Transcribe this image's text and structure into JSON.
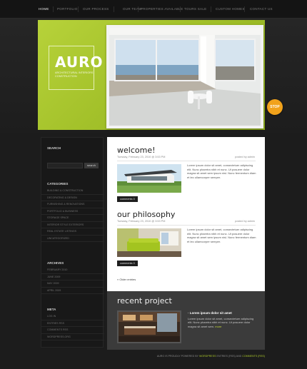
{
  "nav": {
    "items": [
      "Home",
      "Portfolio",
      "Our process",
      "Our team",
      "Properties available",
      "Tours sale",
      "Custom homes",
      "Contact us"
    ]
  },
  "header": {
    "logo_title": "AURO",
    "logo_subtitle": "Architectural Interiors Construction",
    "stop_label": "STOP"
  },
  "sidebar": {
    "search_label": "Search",
    "search_placeholder": "",
    "search_button": "search",
    "categories_label": "Categories",
    "categories": [
      "Building & Construction",
      "Decorating & Design",
      "Furnishing & Renovations",
      "Portfolio & Business",
      "Storage Space",
      "Interior Style Exteriors",
      "Real Estate Listings",
      "Uncategorized"
    ],
    "archives_label": "Archives",
    "archives": [
      "February 2010",
      "June 2009",
      "May 2009",
      "April 2009"
    ],
    "meta_label": "Meta",
    "meta": [
      "Log in",
      "Entries RSS",
      "Comments RSS",
      "WordPress.org"
    ]
  },
  "posts": [
    {
      "title": "welcome!",
      "meta": "Tuesday, February 23, 2010 @ 3:53 PM",
      "author": "posted by admin",
      "text": "Lorem ipsum dolor sit amet, consectetuer adipiscing elit. Nunc pharetra nibh et nunc. Ut posuere dolor magna sit amet sem ipsum nisl. Nunc fermentum diam et leo ullamcorper semper.",
      "comments": "comments 0"
    },
    {
      "title": "our philosophy",
      "meta": "Tuesday, February 23, 2010 @ 3:53 PM",
      "author": "posted by admin",
      "text": "Lorem ipsum dolor sit amet, consectetuer adipiscing elit. Nunc pharetra nibh et nunc. Ut posuere dolor magna sit amet sem ipsum nisl. Nunc fermentum diam et leo ullamcorper semper.",
      "comments": "comments 0"
    }
  ],
  "older_entries": "« Older entries",
  "recent": {
    "title": "recent project",
    "heading": "· Lorem ipsum dolor sit amet",
    "text": "Lorem ipsum dolor sit amet, consectetuer adipiscing elit. Nunc pharetra nibh et nunc. Ut posuere dolor magna sit amet sem.",
    "more": "more"
  },
  "footer": {
    "prefix": "Auro is proudly powered by",
    "link1": "WordPress",
    "mid": "Entries (RSS) and",
    "link2": "Comments (RSS)"
  },
  "colors": {
    "accent": "#a9c52c",
    "stop_button": "#f1a21b",
    "background": "#1c1c1c"
  }
}
